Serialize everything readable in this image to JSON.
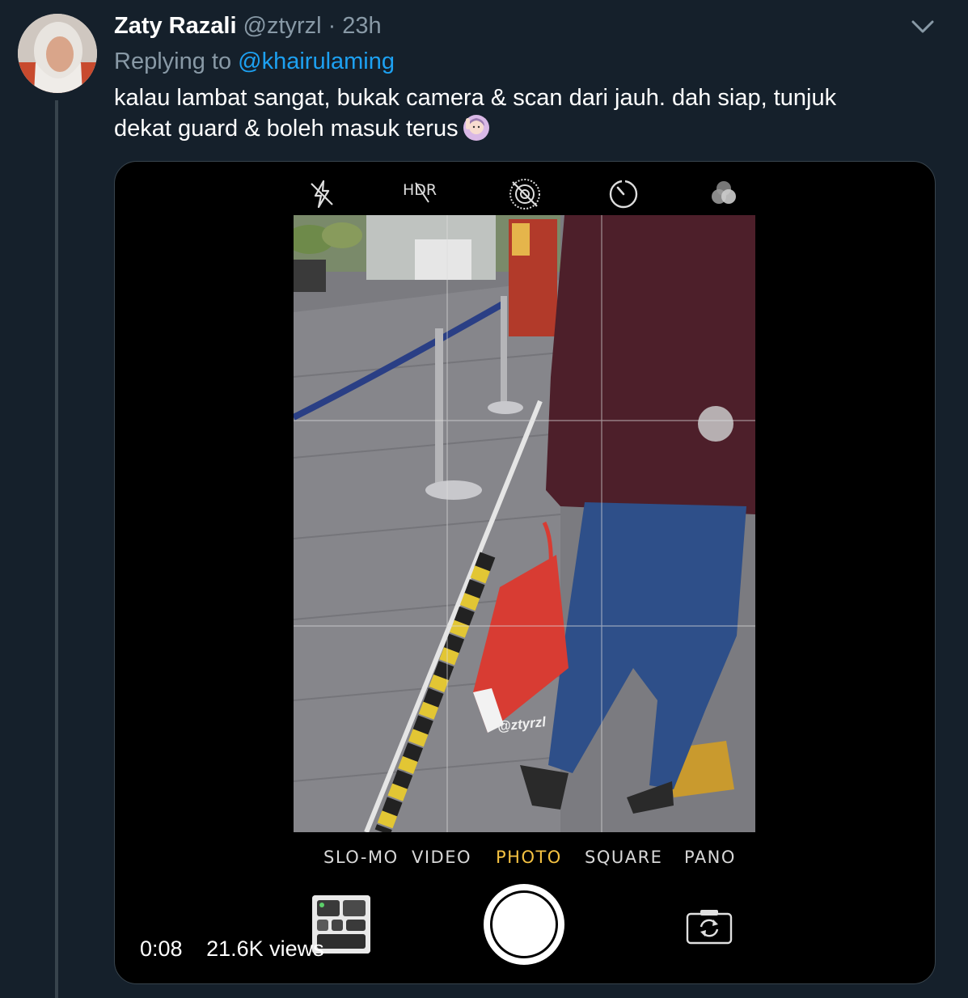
{
  "tweet": {
    "display_name": "Zaty Razali",
    "handle": "@ztyrzl",
    "separator": "·",
    "time": "23h",
    "replying_prefix": "Replying to",
    "replying_to": "@khairulaming",
    "text_line1": "kalau lambat sangat, bukak camera & scan dari jauh. dah siap, tunjuk",
    "text_line2": "dekat guard & boleh masuk terus",
    "emoji_icon": "person-raising-hand-emoji"
  },
  "video": {
    "camera_top_icons": [
      "flash-off-icon",
      "hdr-off-icon",
      "live-photo-off-icon",
      "timer-icon",
      "filters-icon"
    ],
    "hdr_label": "HDR",
    "modes": [
      "SLO-MO",
      "VIDEO",
      "PHOTO",
      "SQUARE",
      "PANO"
    ],
    "active_mode": "PHOTO",
    "watermark": "@ztyrzl",
    "duration": "0:08",
    "views": "21.6K views"
  },
  "colors": {
    "background": "#15202b",
    "secondary_text": "#8899a6",
    "link": "#1da1f2",
    "border": "#38444d",
    "active_mode": "#f5c242"
  }
}
